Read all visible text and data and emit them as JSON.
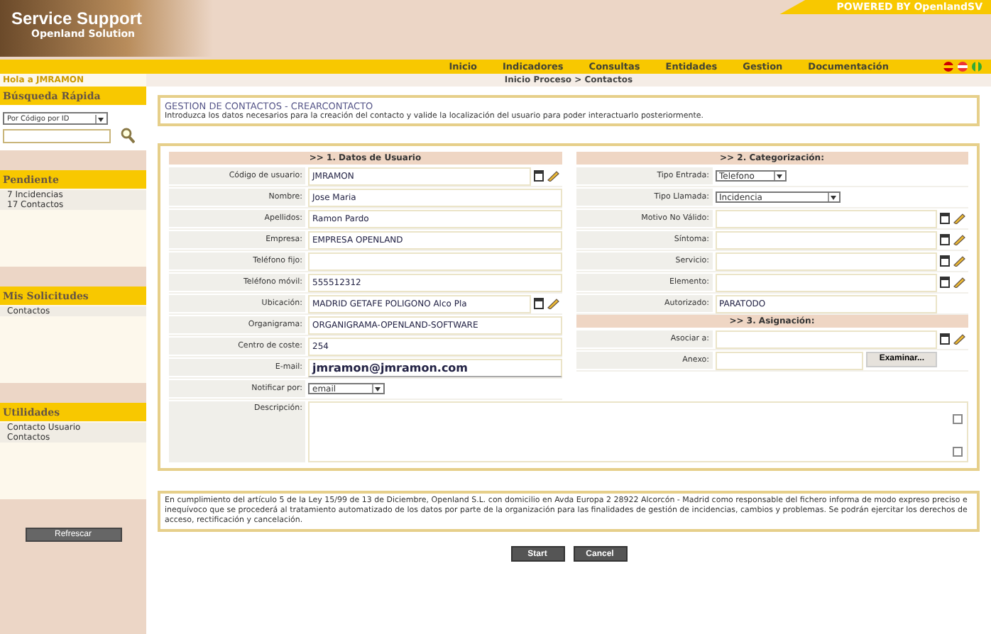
{
  "header": {
    "logo_title": "Service Support",
    "logo_subtitle": "Openland Solution",
    "powered": "POWERED BY OpenlandSV"
  },
  "nav": {
    "items": [
      "Inicio",
      "Indicadores",
      "Consultas",
      "Entidades",
      "Gestion",
      "Documentación"
    ]
  },
  "breadcrumb": "Inicio Proceso > Contactos",
  "sidebar": {
    "user": "Hola a JMRAMON",
    "quick_search": {
      "title": "Búsqueda Rápida",
      "select": "Por Código por ID"
    },
    "sections": [
      {
        "title": "Pendiente",
        "items": [
          "7 Incidencias",
          "17 Contactos"
        ]
      },
      {
        "title": "Mis Solicitudes",
        "items": [
          "Contactos"
        ]
      },
      {
        "title": "Utilidades",
        "items": [
          "Contacto Usuario",
          "Contactos"
        ]
      }
    ],
    "refresh": "Refrescar"
  },
  "page": {
    "title": "GESTION DE CONTACTOS - CREARCONTACTO",
    "intro": "Introduzca los datos necesarios para la creación del contacto y valide la localización del usuario para poder interactuarlo posteriormente."
  },
  "user_section": {
    "heading": ">> 1. Datos de Usuario",
    "fields": [
      {
        "label": "Código de usuario:",
        "value": "JMRAMON",
        "kind": "text",
        "lookup": true
      },
      {
        "label": "Nombre:",
        "value": "Jose Maria",
        "kind": "text",
        "lookup": false
      },
      {
        "label": "Apellidos:",
        "value": "Ramon Pardo",
        "kind": "text",
        "lookup": false
      },
      {
        "label": "Empresa:",
        "value": "EMPRESA OPENLAND",
        "kind": "text",
        "lookup": false
      },
      {
        "label": "Teléfono fijo:",
        "kind": "text",
        "lookup": false
      },
      {
        "label": "Teléfono móvil:",
        "value": "555512312",
        "kind": "text",
        "lookup": false
      },
      {
        "label": "Ubicación:",
        "value": "MADRID GETAFE POLIGONO Alco Pla",
        "kind": "text",
        "lookup": true
      },
      {
        "label": "Organigrama:",
        "value": "ORGANIGRAMA-OPENLAND-SOFTWARE",
        "kind": "text",
        "lookup": false
      },
      {
        "label": "Centro de coste:",
        "value": "254",
        "kind": "text",
        "lookup": false
      },
      {
        "label": "E-mail:",
        "value": "jmramon@jmramon.com",
        "kind": "email",
        "lookup": false
      },
      {
        "label": "Notificar por:",
        "value": "email",
        "kind": "select",
        "lookup": false
      }
    ]
  },
  "category_section": {
    "heading": ">> 2. Categorización:",
    "fields": [
      {
        "label": "Tipo Entrada:",
        "value": "Telefono",
        "kind": "select",
        "lookup": false
      },
      {
        "label": "Tipo Llamada:",
        "value": "Incidencia",
        "kind": "select",
        "lookup": false
      },
      {
        "label": "Motivo No Válido:",
        "kind": "text",
        "lookup": true
      },
      {
        "label": "Síntoma:",
        "kind": "text",
        "lookup": true
      },
      {
        "label": "Servicio:",
        "kind": "text",
        "lookup": true
      },
      {
        "label": "Elemento:",
        "kind": "text",
        "lookup": true
      },
      {
        "label": "Autorizado:",
        "value": "PARATODO",
        "kind": "text",
        "lookup": false
      }
    ]
  },
  "assign_section": {
    "heading": ">> 3. Asignación:",
    "fields": [
      {
        "label": "Asociar a:",
        "kind": "text",
        "lookup": true
      },
      {
        "label": "Anexo:",
        "kind": "file",
        "button": "Examinar...",
        "lookup": false
      }
    ]
  },
  "description": {
    "label": "Descripción:"
  },
  "legal": "En cumplimiento del artículo 5 de la Ley 15/99 de 13 de Diciembre, Openland S.L. con domicilio en Avda Europa 2 28922 Alcorcón - Madrid como responsable del fichero informa de modo expreso preciso e inequívoco que se procederá al tratamiento automatizado de los datos por parte de la organización para las finalidades de gestión de incidencias, cambios y problemas. Se podrán ejercitar los derechos de acceso, rectificación y cancelación.",
  "buttons": [
    "Start",
    "Cancel"
  ]
}
